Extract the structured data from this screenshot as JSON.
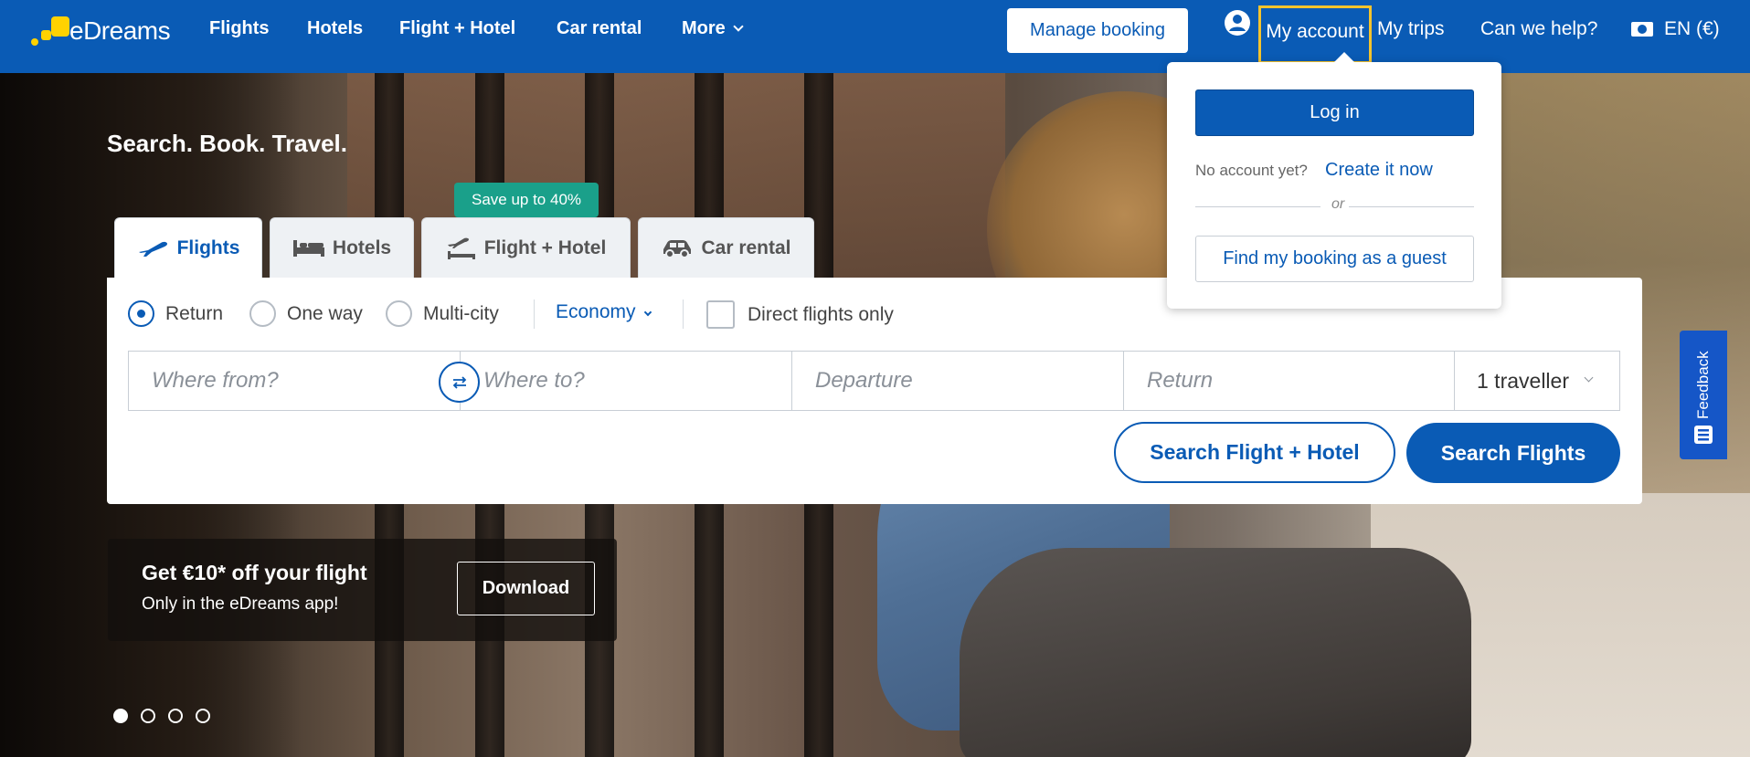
{
  "header": {
    "logo_text": "eDreams",
    "nav": [
      {
        "label": "Flights"
      },
      {
        "label": "Hotels"
      },
      {
        "label": "Flight + Hotel"
      },
      {
        "label": "Car rental"
      },
      {
        "label": "More"
      }
    ],
    "manage_booking": "Manage booking",
    "account_icon": "user-circle-icon",
    "my_account": "My account",
    "my_trips": "My trips",
    "help": "Can we help?",
    "language": "EN (€)",
    "brand_color": "#0a5bb5",
    "highlight_color": "#f5c42c"
  },
  "account_menu": {
    "login": "Log in",
    "no_account": "No account yet?",
    "create": "Create it now",
    "or": "or",
    "guest": "Find my booking as a guest"
  },
  "hero": {
    "tagline": "Search. Book. Travel."
  },
  "search": {
    "promo_badge": "Save up to 40%",
    "tabs": [
      {
        "label": "Flights",
        "icon": "plane-icon",
        "active": true
      },
      {
        "label": "Hotels",
        "icon": "bed-icon",
        "active": false
      },
      {
        "label": "Flight + Hotel",
        "icon": "plane-hotel-icon",
        "active": false
      },
      {
        "label": "Car rental",
        "icon": "car-icon",
        "active": false
      }
    ],
    "trip_types": [
      {
        "label": "Return",
        "selected": true
      },
      {
        "label": "One way",
        "selected": false
      },
      {
        "label": "Multi-city",
        "selected": false
      }
    ],
    "cabin_class": "Economy",
    "direct_only": "Direct flights only",
    "direct_only_checked": false,
    "fields": {
      "from": "Where from?",
      "to": "Where to?",
      "departure": "Departure",
      "return": "Return"
    },
    "travellers": "1 traveller",
    "btn_flight_hotel": "Search Flight + Hotel",
    "btn_search": "Search Flights"
  },
  "promo": {
    "title": "Get €10* off your flight",
    "subtitle": "Only in the eDreams app!",
    "button": "Download"
  },
  "carousel": {
    "count": 4,
    "active_index": 0
  },
  "feedback": {
    "label": "Feedback"
  }
}
